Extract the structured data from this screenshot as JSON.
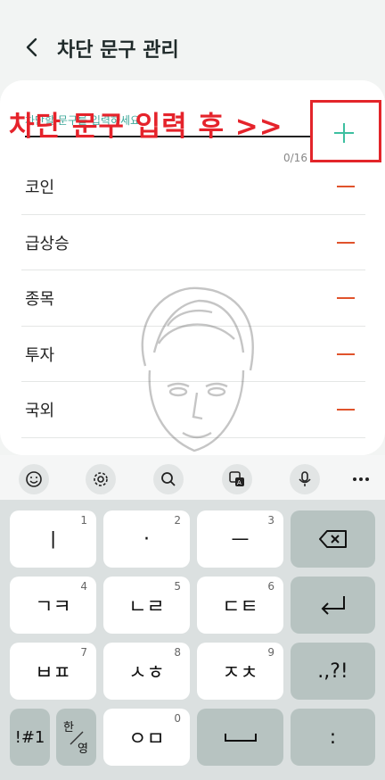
{
  "header": {
    "title": "차단 문구 관리"
  },
  "input": {
    "placeholder": "차단할 문구를 입력하세요.",
    "counter": "0/16"
  },
  "annotation": {
    "text": "차단 문구 입력 후 >>"
  },
  "blocked_phrases": [
    {
      "label": "코인"
    },
    {
      "label": "급상승"
    },
    {
      "label": "종목"
    },
    {
      "label": "투자"
    },
    {
      "label": "국외"
    }
  ],
  "keyboard_toolbar": [
    "emoji-icon",
    "settings-icon",
    "search-icon",
    "translate-icon",
    "mic-icon",
    "more-icon"
  ],
  "keyboard": {
    "row1": [
      {
        "main": "ㅣ",
        "num": "1"
      },
      {
        "main": "·",
        "num": "2"
      },
      {
        "main": "ㅡ",
        "num": "3"
      }
    ],
    "row2": [
      {
        "main": "ㄱㅋ",
        "num": "4"
      },
      {
        "main": "ㄴㄹ",
        "num": "5"
      },
      {
        "main": "ㄷㅌ",
        "num": "6"
      }
    ],
    "row3": [
      {
        "main": "ㅂㅍ",
        "num": "7"
      },
      {
        "main": "ㅅㅎ",
        "num": "8"
      },
      {
        "main": "ㅈㅊ",
        "num": "9"
      }
    ],
    "punct": ".,?!",
    "symbols": "!#1",
    "lang_top": "한",
    "lang_bottom": "영",
    "row4_mid": {
      "main": "ㅇㅁ",
      "num": "0"
    },
    "colon": ":"
  },
  "colors": {
    "accent": "#3dbfa0",
    "annotation": "#e5232b",
    "minus": "#e0532c"
  }
}
